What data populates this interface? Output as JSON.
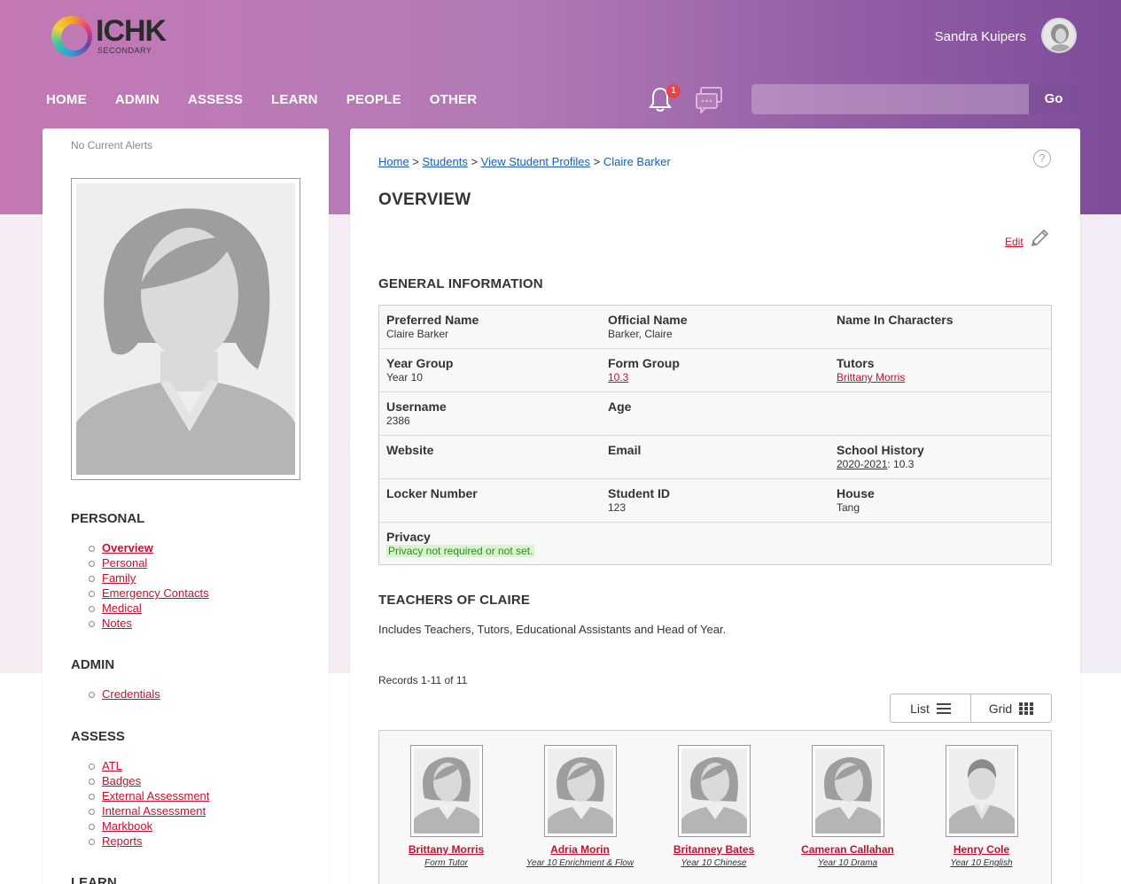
{
  "header": {
    "logo_text": "ICHK",
    "logo_sub": "SECONDARY",
    "user_name": "Sandra Kuipers",
    "notification_count": "1",
    "search_placeholder": "",
    "search_go": "Go"
  },
  "nav": [
    "HOME",
    "ADMIN",
    "ASSESS",
    "LEARN",
    "PEOPLE",
    "OTHER"
  ],
  "sidebar": {
    "alerts": "No Current Alerts",
    "sections": [
      {
        "title": "PERSONAL",
        "items": [
          "Overview",
          "Personal",
          "Family",
          "Emergency Contacts",
          "Medical",
          "Notes"
        ]
      },
      {
        "title": "ADMIN",
        "items": [
          "Credentials"
        ]
      },
      {
        "title": "ASSESS",
        "items": [
          "ATL",
          "Badges",
          "External Assessment",
          "Internal Assessment",
          "Markbook",
          "Reports"
        ]
      },
      {
        "title": "LEARN",
        "items": []
      }
    ]
  },
  "breadcrumb": {
    "items": [
      "Home",
      "Students",
      "View Student Profiles"
    ],
    "current": "Claire Barker",
    "sep": " > "
  },
  "main": {
    "help": "?",
    "title": "OVERVIEW",
    "edit": "Edit",
    "general_title": "GENERAL INFORMATION",
    "teachers_title": "TEACHERS OF CLAIRE",
    "teachers_desc": "Includes Teachers, Tutors, Educational Assistants and Head of Year.",
    "records": "Records 1-11 of 11",
    "view_list": "List",
    "view_grid": "Grid"
  },
  "general": {
    "preferred_name_label": "Preferred Name",
    "preferred_name": "Claire Barker",
    "official_name_label": "Official Name",
    "official_name": "Barker, Claire",
    "name_chars_label": "Name In Characters",
    "name_chars": "",
    "year_group_label": "Year Group",
    "year_group": "Year 10",
    "form_group_label": "Form Group",
    "form_group": "10.3",
    "tutors_label": "Tutors",
    "tutors": "Brittany Morris",
    "username_label": "Username",
    "username": "2386",
    "age_label": "Age",
    "age": "",
    "website_label": "Website",
    "website": "",
    "email_label": "Email",
    "email": "",
    "school_history_label": "School History",
    "school_history_year": "2020-2021",
    "school_history_value": ": 10.3",
    "locker_label": "Locker Number",
    "locker": "",
    "student_id_label": "Student ID",
    "student_id": "123",
    "house_label": "House",
    "house": "Tang",
    "privacy_label": "Privacy",
    "privacy": "Privacy not required or not set."
  },
  "teachers": [
    {
      "name": "Brittany Morris",
      "role": "Form Tutor",
      "gender": "female"
    },
    {
      "name": "Adria Morin",
      "role": "Year 10 Enrichment & Flow",
      "gender": "female"
    },
    {
      "name": "Britanney Bates",
      "role": "Year 10 Chinese",
      "gender": "female"
    },
    {
      "name": "Cameran Callahan",
      "role": "Year 10 Drama",
      "gender": "female"
    },
    {
      "name": "Henry Cole",
      "role": "Year 10 English",
      "gender": "male"
    }
  ],
  "colors": {
    "accent_link": "#c8102e",
    "breadcrumb_link": "#1c5fa8",
    "header_start": "#c479b6",
    "header_end": "#7f4c9a"
  }
}
